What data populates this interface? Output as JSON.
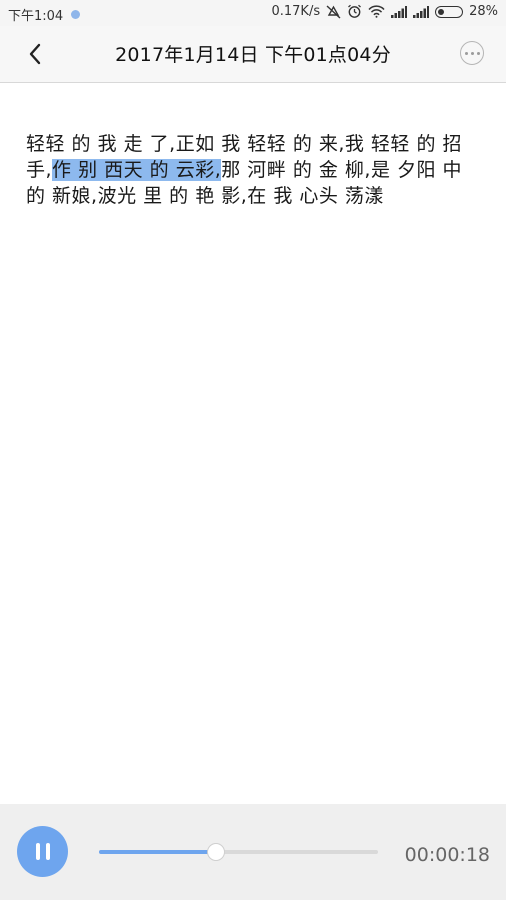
{
  "status_bar": {
    "time": "下午1:04",
    "network_speed": "0.17K/s",
    "battery": "28%",
    "battery_level": 0.28
  },
  "header": {
    "title": "2017年1月14日 下午01点04分",
    "back_icon": "chevron-left-icon",
    "more_icon": "more-dots-icon"
  },
  "content": {
    "text_before": "轻轻 的 我 走 了,正如 我 轻轻 的 来,我 轻轻 的 招手,",
    "text_highlight": "作 别 西天 的 云彩,",
    "text_after": "那 河畔 的 金 柳,是 夕阳 中 的 新娘,波光 里 的 艳 影,在 我 心头 荡漾"
  },
  "player": {
    "state": "playing",
    "pause_icon": "pause-icon",
    "progress": 0.42,
    "elapsed": "00:00:18"
  },
  "colors": {
    "accent": "#6ea5ee",
    "highlight": "#8db9ee"
  }
}
